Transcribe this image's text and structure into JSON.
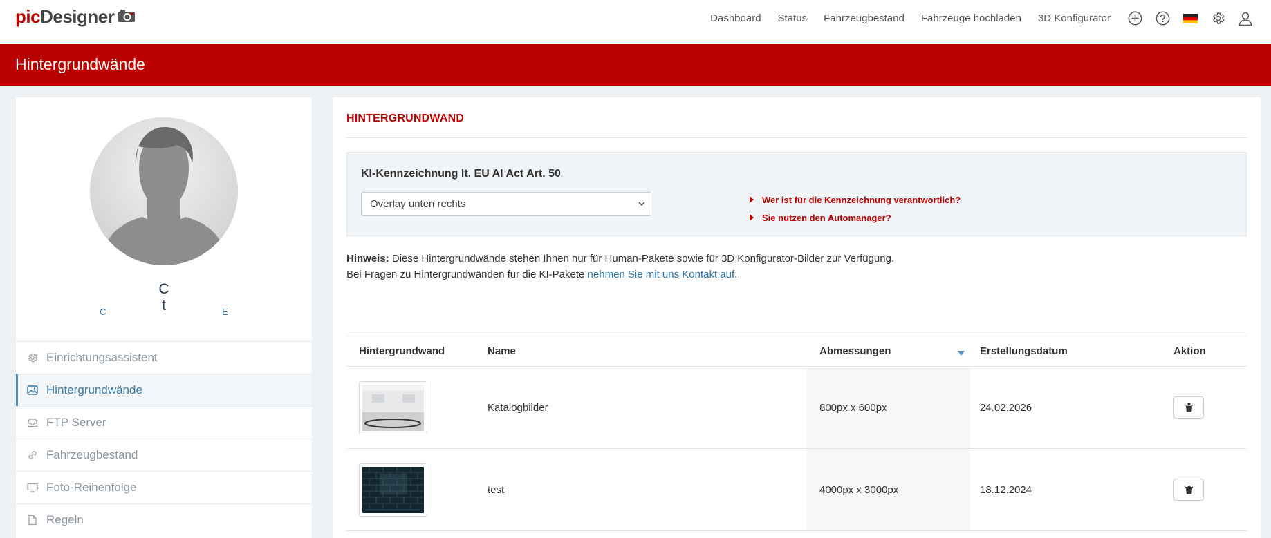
{
  "brand": {
    "part1": "pic",
    "part2": "Designer"
  },
  "nav": {
    "links": [
      "Dashboard",
      "Status",
      "Fahrzeugbestand",
      "Fahrzeuge hochladen",
      "3D Konfigurator"
    ],
    "icons": [
      "plus-circle-icon",
      "help-icon",
      "german-flag-icon",
      "gear-icon",
      "user-icon"
    ]
  },
  "page": {
    "title": "Hintergrundwände"
  },
  "user": {
    "name": "C t",
    "sub": "C E"
  },
  "sidebar": {
    "items": [
      {
        "label": "Einrichtungsassistent",
        "icon": "gear-icon",
        "active": false
      },
      {
        "label": "Hintergrundwände",
        "icon": "image-icon",
        "active": true
      },
      {
        "label": "FTP Server",
        "icon": "inbox-icon",
        "active": false
      },
      {
        "label": "Fahrzeugbestand",
        "icon": "link-icon",
        "active": false
      },
      {
        "label": "Foto-Reihenfolge",
        "icon": "monitor-icon",
        "active": false
      },
      {
        "label": "Regeln",
        "icon": "document-icon",
        "active": false
      }
    ]
  },
  "section": {
    "title": "HINTERGRUNDWAND"
  },
  "ki": {
    "title": "KI-Kennzeichnung lt. EU AI Act Art. 50",
    "selected": "Overlay unten rechts",
    "links": [
      "Wer ist für die Kennzeichnung verantwortlich?",
      "Sie nutzen den Automanager?"
    ]
  },
  "hint": {
    "label": "Hinweis:",
    "line1": "Diese Hintergrundwände stehen Ihnen nur für Human-Pakete sowie für 3D Konfigurator-Bilder zur Verfügung.",
    "line2_prefix": "Bei Fragen zu Hintergrundwänden für die KI-Pakete",
    "link": "nehmen Sie mit uns Kontakt auf",
    "line2_suffix": "."
  },
  "table": {
    "headers": [
      "Hintergrundwand",
      "Name",
      "Abmessungen",
      "Erstellungsdatum",
      "Aktion"
    ],
    "rows": [
      {
        "name": "Katalogbilder",
        "size": "800px x 600px",
        "date": "24.02.2026"
      },
      {
        "name": "test",
        "size": "4000px x 3000px",
        "date": "18.12.2024"
      }
    ]
  },
  "colors": {
    "brand_red": "#bb0000",
    "link_blue": "#2a73ad"
  }
}
